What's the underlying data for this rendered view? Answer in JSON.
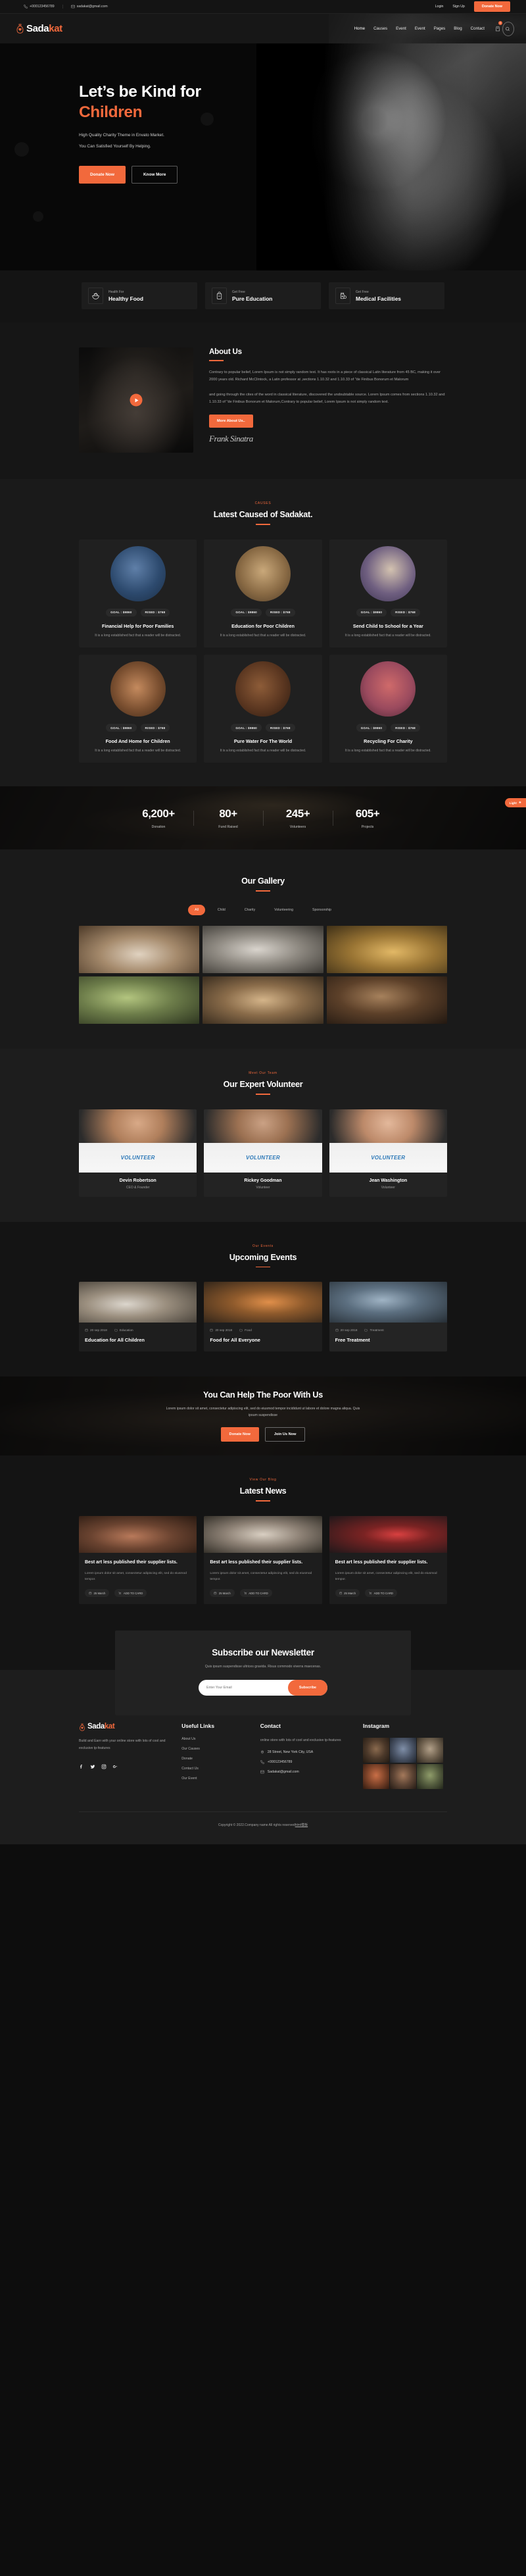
{
  "topbar": {
    "phone": "+000123456789",
    "email": "sadakat@gmail.com",
    "login": "Login",
    "signup": "Sign Up",
    "donate": "Donate Now"
  },
  "brand": {
    "part1": "Sada",
    "part2": "kat"
  },
  "nav": {
    "items": [
      "Home",
      "Causes",
      "Event",
      "Event",
      "Pages",
      "Blog",
      "Contact"
    ],
    "cart_count": "0"
  },
  "hero": {
    "title_line1": "Let’s be Kind for",
    "title_line2": "Children",
    "sub1": "High Quality Charity Theme in Envato Market.",
    "sub2": "You Can Satisfied Yourself By Helping.",
    "btn_primary": "Donate Now",
    "btn_secondary": "Know More"
  },
  "features": [
    {
      "sub": "Health For",
      "title": "Healthy Food",
      "icon": "food-bowl-icon"
    },
    {
      "sub": "Get Free",
      "title": "Pure Education",
      "icon": "backpack-icon"
    },
    {
      "sub": "Get Free",
      "title": "Medical Facilities",
      "icon": "medicine-icon"
    }
  ],
  "about": {
    "title": "About Us",
    "p1": "Contrary to popular belief, Lorem Ipsum is not simply random text. It has roots in a piece of classical Latin literature from 45 BC, making it over 2000 years old. Richard McClintock, a Latin professor at ,sections 1.10.32 and 1.10.33 of \"de Finibus Bonorum et Malorum",
    "p2": "and going through the cites of the word in classical literature, discovered the undoubtable source. Lorem Ipsum comes from sections 1.10.32 and 1.10.33 of \"de Finibus Bonorum et Malorum,Contrary to popular belief, Lorem Ipsum is not simply random text.",
    "button": "More About Us..",
    "signature": "Frank Sinatra"
  },
  "causes": {
    "kicker": "CAUSES",
    "title": "Latest Caused of Sadakat.",
    "cards": [
      {
        "goal": "GOAL : $9860",
        "rised": "RISED : $768",
        "title": "Financial Help for Poor Families",
        "desc": "It is a long established fact that a reader will be distracted."
      },
      {
        "goal": "GOAL : $9860",
        "rised": "RISED : $768",
        "title": "Education for Poor Children",
        "desc": "It is a long established fact that a reader will be distracted."
      },
      {
        "goal": "GOAL : $9860",
        "rised": "RISED : $768",
        "title": "Send Child to School for a Year",
        "desc": "It is a long established fact that a reader will be distracted."
      },
      {
        "goal": "GOAL : $9860",
        "rised": "RISED : $768",
        "title": "Food And Home for Children",
        "desc": "It is a long established fact that a reader will be distracted."
      },
      {
        "goal": "GOAL : $9860",
        "rised": "RISED : $768",
        "title": "Pure Water For The World",
        "desc": "It is a long established fact that a reader will be distracted."
      },
      {
        "goal": "GOAL : $9860",
        "rised": "RISED : $768",
        "title": "Recycling For Charity",
        "desc": "It is a long established fact that a reader will be distracted."
      }
    ]
  },
  "stats": {
    "light_chip": "Light",
    "items": [
      {
        "num": "6,200+",
        "label": "Donation"
      },
      {
        "num": "80+",
        "label": "Fund Raised"
      },
      {
        "num": "245+",
        "label": "Volunteers"
      },
      {
        "num": "605+",
        "label": "Projects"
      }
    ]
  },
  "gallery": {
    "title": "Our Gallery",
    "filters": [
      "All",
      "Child",
      "Charity",
      "Volunteering",
      "Sponsorship"
    ],
    "active_filter": "All"
  },
  "volunteers": {
    "kicker": "Meet Our Team",
    "title": "Our Expert Volunteer",
    "shirt_text": "VOLUNTEER",
    "members": [
      {
        "name": "Devin Robertson",
        "role": "CEO & Founder"
      },
      {
        "name": "Rickey Goodman",
        "role": "Volunteer"
      },
      {
        "name": "Jean Washington",
        "role": "Volunteer"
      }
    ]
  },
  "events": {
    "kicker": "Our Events",
    "title": "Upcoming Events",
    "cards": [
      {
        "date": "20 sep 2018",
        "category": "Education",
        "title": "Education for All Children"
      },
      {
        "date": "20 sep 2018",
        "category": "Food",
        "title": "Food for All Everyone"
      },
      {
        "date": "20 sep 2018",
        "category": "Treatment",
        "title": "Free Treatment"
      }
    ]
  },
  "cta": {
    "title": "You Can Help The Poor With Us",
    "desc": "Lorem ipsum dolor sit amet, consectetur adipiscing elit, sed do eiusmod tempor incididunt ut labore et dolore magna aliqua. Quis ipsum suspendisse",
    "btn_primary": "Donate Now",
    "btn_secondary": "Join Us Now"
  },
  "news": {
    "kicker": "View Our Blog",
    "title": "Latest News",
    "cards": [
      {
        "title": "Best art less published their supplier lists.",
        "desc": "Lorem ipsum dolor sit amet, consectetur adipiscing elit, sed do eiusmod tempor.",
        "date": "25 March",
        "comments": "ADD TO CARD"
      },
      {
        "title": "Best art less published their supplier lists.",
        "desc": "Lorem ipsum dolor sit amet, consectetur adipiscing elit, sed do eiusmod tempor.",
        "date": "25 March",
        "comments": "ADD TO CARD"
      },
      {
        "title": "Best art less published their supplier lists.",
        "desc": "Lorem ipsum dolor sit amet, consectetur adipiscing elit, sed do eiusmod tempor.",
        "date": "25 March",
        "comments": "ADD TO CARD"
      }
    ]
  },
  "newsletter": {
    "title": "Subscribe our Newsletter",
    "desc": "Quis ipsum suspendisse ultrices gravida. Risus commodo viverra maecenas.",
    "placeholder": "Enter Your Email",
    "button": "Subscribe"
  },
  "footer": {
    "about": "Build and Earn with your online store with lots of cool and exclusive tp-features",
    "links_heading": "Useful Links",
    "links": [
      "About Us",
      "Our Causes",
      "Donate",
      "Contact Us",
      "Our Event"
    ],
    "contact_heading": "Contact",
    "contact_desc": "online store with lots of cool and exclusive tp-features",
    "address": "28 Street, New York City, USA",
    "phone": "+000123456789",
    "email": "Sadakat@gmail.com",
    "instagram_heading": "Instagram",
    "copyright": "Copyright © 2022.Company name All rights reserved",
    "copyright_link": "html模板"
  },
  "colors": {
    "accent": "#f2693c",
    "bg": "#1a1a1a",
    "panel": "#222222"
  }
}
